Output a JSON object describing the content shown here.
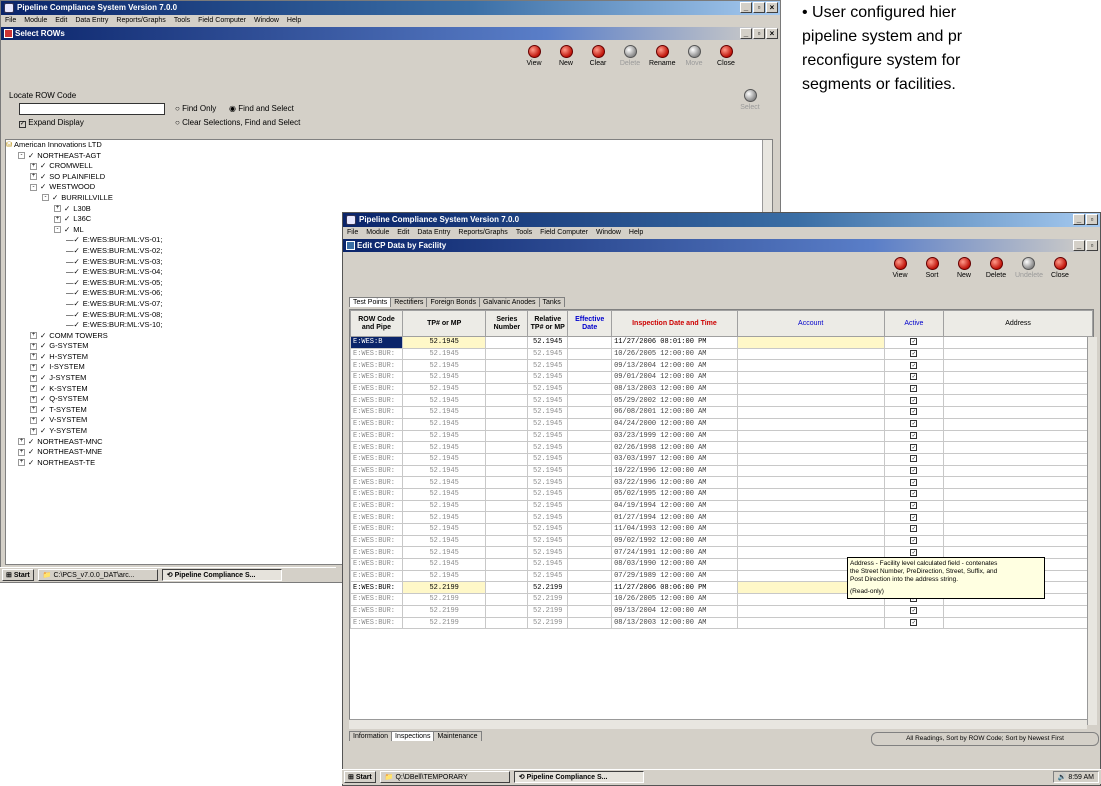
{
  "note": {
    "lines": [
      "• User configured hier",
      "pipeline system and pr",
      "reconfigure system for",
      "segments or facilities."
    ]
  },
  "window1": {
    "title": "Pipeline Compliance System Version 7.0.0",
    "menu": [
      "File",
      "Module",
      "Edit",
      "Data Entry",
      "Reports/Graphs",
      "Tools",
      "Field Computer",
      "Window",
      "Help"
    ],
    "subwindow_title": "Select ROWs",
    "toolbar": [
      {
        "label": "View",
        "enabled": true
      },
      {
        "label": "New",
        "enabled": true
      },
      {
        "label": "Clear",
        "enabled": true
      },
      {
        "label": "Delete",
        "enabled": false
      },
      {
        "label": "Rename",
        "enabled": true
      },
      {
        "label": "Move",
        "enabled": false
      },
      {
        "label": "Close",
        "enabled": true
      }
    ],
    "locate_label": "Locate ROW Code",
    "locate_value": "",
    "find_only": "Find Only",
    "find_select": "Find and Select",
    "expand_display": "Expand Display",
    "clear_select": "Clear Selections, Find and Select",
    "select_label": "Select",
    "tree_root": "American Innovations LTD",
    "tree": [
      {
        "d": 1,
        "e": "-",
        "t": "NORTHEAST-AGT"
      },
      {
        "d": 2,
        "e": "+",
        "t": "CROMWELL"
      },
      {
        "d": 2,
        "e": "+",
        "t": "SO PLAINFIELD"
      },
      {
        "d": 2,
        "e": "-",
        "t": "WESTWOOD"
      },
      {
        "d": 3,
        "e": "-",
        "t": "BURRILLVILLE"
      },
      {
        "d": 4,
        "e": "+",
        "t": "L30B"
      },
      {
        "d": 4,
        "e": "+",
        "t": "L36C"
      },
      {
        "d": 4,
        "e": "-",
        "t": "ML"
      },
      {
        "d": 5,
        "e": "",
        "t": "E:WES:BUR:ML:VS-01;"
      },
      {
        "d": 5,
        "e": "",
        "t": "E:WES:BUR:ML:VS-02;"
      },
      {
        "d": 5,
        "e": "",
        "t": "E:WES:BUR:ML:VS-03;"
      },
      {
        "d": 5,
        "e": "",
        "t": "E:WES:BUR:ML:VS-04;"
      },
      {
        "d": 5,
        "e": "",
        "t": "E:WES:BUR:ML:VS-05;"
      },
      {
        "d": 5,
        "e": "",
        "t": "E:WES:BUR:ML:VS-06;"
      },
      {
        "d": 5,
        "e": "",
        "t": "E:WES:BUR:ML:VS-07;"
      },
      {
        "d": 5,
        "e": "",
        "t": "E:WES:BUR:ML:VS-08;"
      },
      {
        "d": 5,
        "e": "",
        "t": "E:WES:BUR:ML:VS-10;"
      },
      {
        "d": 2,
        "e": "+",
        "t": "COMM TOWERS"
      },
      {
        "d": 2,
        "e": "+",
        "t": "G-SYSTEM"
      },
      {
        "d": 2,
        "e": "+",
        "t": "H-SYSTEM"
      },
      {
        "d": 2,
        "e": "+",
        "t": "I-SYSTEM"
      },
      {
        "d": 2,
        "e": "+",
        "t": "J-SYSTEM"
      },
      {
        "d": 2,
        "e": "+",
        "t": "K-SYSTEM"
      },
      {
        "d": 2,
        "e": "+",
        "t": "Q-SYSTEM"
      },
      {
        "d": 2,
        "e": "+",
        "t": "T-SYSTEM"
      },
      {
        "d": 2,
        "e": "+",
        "t": "V-SYSTEM"
      },
      {
        "d": 2,
        "e": "+",
        "t": "Y-SYSTEM"
      },
      {
        "d": 1,
        "e": "+",
        "t": "NORTHEAST-MNC"
      },
      {
        "d": 1,
        "e": "+",
        "t": "NORTHEAST-MNE"
      },
      {
        "d": 1,
        "e": "+",
        "t": "NORTHEAST-TE"
      }
    ],
    "taskbar": {
      "start": "Start",
      "item1": "C:\\PCS_v7.0.0_DAT\\arc...",
      "item2": "Pipeline Compliance S..."
    }
  },
  "window2": {
    "title": "Pipeline Compliance System Version 7.0.0",
    "menu": [
      "File",
      "Module",
      "Edit",
      "Data Entry",
      "Reports/Graphs",
      "Tools",
      "Field Computer",
      "Window",
      "Help"
    ],
    "subwindow_title": "Edit CP Data by Facility",
    "toolbar": [
      {
        "label": "View",
        "enabled": true
      },
      {
        "label": "Sort",
        "enabled": true
      },
      {
        "label": "New",
        "enabled": true
      },
      {
        "label": "Delete",
        "enabled": true
      },
      {
        "label": "Undelete",
        "enabled": false
      },
      {
        "label": "Close",
        "enabled": true
      }
    ],
    "tabs": [
      "Test Points",
      "Rectifiers",
      "Foreign Bonds",
      "Galvanic Anodes",
      "Tanks"
    ],
    "columns": [
      "ROW Code and Pipe",
      "TP# or MP",
      "Series Number",
      "Relative TP# or MP",
      "Effective Date",
      "Inspection Date and Time",
      "Account",
      "Active",
      "Address"
    ],
    "rows": [
      {
        "row": "E:WES:B",
        "tp": "52.1945",
        "rel": "52.1945",
        "date": "11/27/2006 08:01:00 PM",
        "hl": true
      },
      {
        "row": "E:WES:BUR:",
        "tp": "52.1945",
        "rel": "52.1945",
        "date": "10/26/2005 12:00:00 AM"
      },
      {
        "row": "E:WES:BUR:",
        "tp": "52.1945",
        "rel": "52.1945",
        "date": "09/13/2004 12:00:00 AM"
      },
      {
        "row": "E:WES:BUR:",
        "tp": "52.1945",
        "rel": "52.1945",
        "date": "09/01/2004 12:00:00 AM"
      },
      {
        "row": "E:WES:BUR:",
        "tp": "52.1945",
        "rel": "52.1945",
        "date": "08/13/2003 12:00:00 AM"
      },
      {
        "row": "E:WES:BUR:",
        "tp": "52.1945",
        "rel": "52.1945",
        "date": "05/29/2002 12:00:00 AM"
      },
      {
        "row": "E:WES:BUR:",
        "tp": "52.1945",
        "rel": "52.1945",
        "date": "06/08/2001 12:00:00 AM"
      },
      {
        "row": "E:WES:BUR:",
        "tp": "52.1945",
        "rel": "52.1945",
        "date": "04/24/2000 12:00:00 AM"
      },
      {
        "row": "E:WES:BUR:",
        "tp": "52.1945",
        "rel": "52.1945",
        "date": "03/23/1999 12:00:00 AM"
      },
      {
        "row": "E:WES:BUR:",
        "tp": "52.1945",
        "rel": "52.1945",
        "date": "02/26/1998 12:00:00 AM"
      },
      {
        "row": "E:WES:BUR:",
        "tp": "52.1945",
        "rel": "52.1945",
        "date": "03/03/1997 12:00:00 AM"
      },
      {
        "row": "E:WES:BUR:",
        "tp": "52.1945",
        "rel": "52.1945",
        "date": "10/22/1996 12:00:00 AM"
      },
      {
        "row": "E:WES:BUR:",
        "tp": "52.1945",
        "rel": "52.1945",
        "date": "03/22/1996 12:00:00 AM"
      },
      {
        "row": "E:WES:BUR:",
        "tp": "52.1945",
        "rel": "52.1945",
        "date": "05/02/1995 12:00:00 AM"
      },
      {
        "row": "E:WES:BUR:",
        "tp": "52.1945",
        "rel": "52.1945",
        "date": "04/19/1994 12:00:00 AM"
      },
      {
        "row": "E:WES:BUR:",
        "tp": "52.1945",
        "rel": "52.1945",
        "date": "01/27/1994 12:00:00 AM"
      },
      {
        "row": "E:WES:BUR:",
        "tp": "52.1945",
        "rel": "52.1945",
        "date": "11/04/1993 12:00:00 AM"
      },
      {
        "row": "E:WES:BUR:",
        "tp": "52.1945",
        "rel": "52.1945",
        "date": "09/02/1992 12:00:00 AM"
      },
      {
        "row": "E:WES:BUR:",
        "tp": "52.1945",
        "rel": "52.1945",
        "date": "07/24/1991 12:00:00 AM"
      },
      {
        "row": "E:WES:BUR:",
        "tp": "52.1945",
        "rel": "52.1945",
        "date": "08/03/1990 12:00:00 AM"
      },
      {
        "row": "E:WES:BUR:",
        "tp": "52.1945",
        "rel": "52.1945",
        "date": "07/29/1989 12:00:00 AM"
      },
      {
        "row": "E:WES:BUR:",
        "tp": "52.2199",
        "rel": "52.2199",
        "date": "11/27/2006 08:06:00 PM",
        "hl": true
      },
      {
        "row": "E:WES:BUR:",
        "tp": "52.2199",
        "rel": "52.2199",
        "date": "10/26/2005 12:00:00 AM"
      },
      {
        "row": "E:WES:BUR:",
        "tp": "52.2199",
        "rel": "52.2199",
        "date": "09/13/2004 12:00:00 AM"
      },
      {
        "row": "E:WES:BUR:",
        "tp": "52.2199",
        "rel": "52.2199",
        "date": "08/13/2003 12:00:00 AM"
      }
    ],
    "tooltip": {
      "line1": "Address - Facility level calculated field - contenates",
      "line2": "the Street Number, PreDirection, Street, Suffix, and",
      "line3": "Post Direction into the address string.",
      "line4": "(Read-only)"
    },
    "bottom_tabs": [
      "Information",
      "Inspections",
      "Maintenance"
    ],
    "status": "All Readings, Sort by ROW Code; Sort by Newest First",
    "taskbar": {
      "start": "Start",
      "item1": "Q:\\DBell\\TEMPORARY",
      "item2": "Pipeline Compliance S...",
      "clock": "8:59 AM"
    }
  },
  "colors": {
    "title_blue": "#0a246a",
    "header_red": "#cc0000",
    "header_blue": "#0000cc",
    "cell_yellow": "#fff8c8"
  }
}
